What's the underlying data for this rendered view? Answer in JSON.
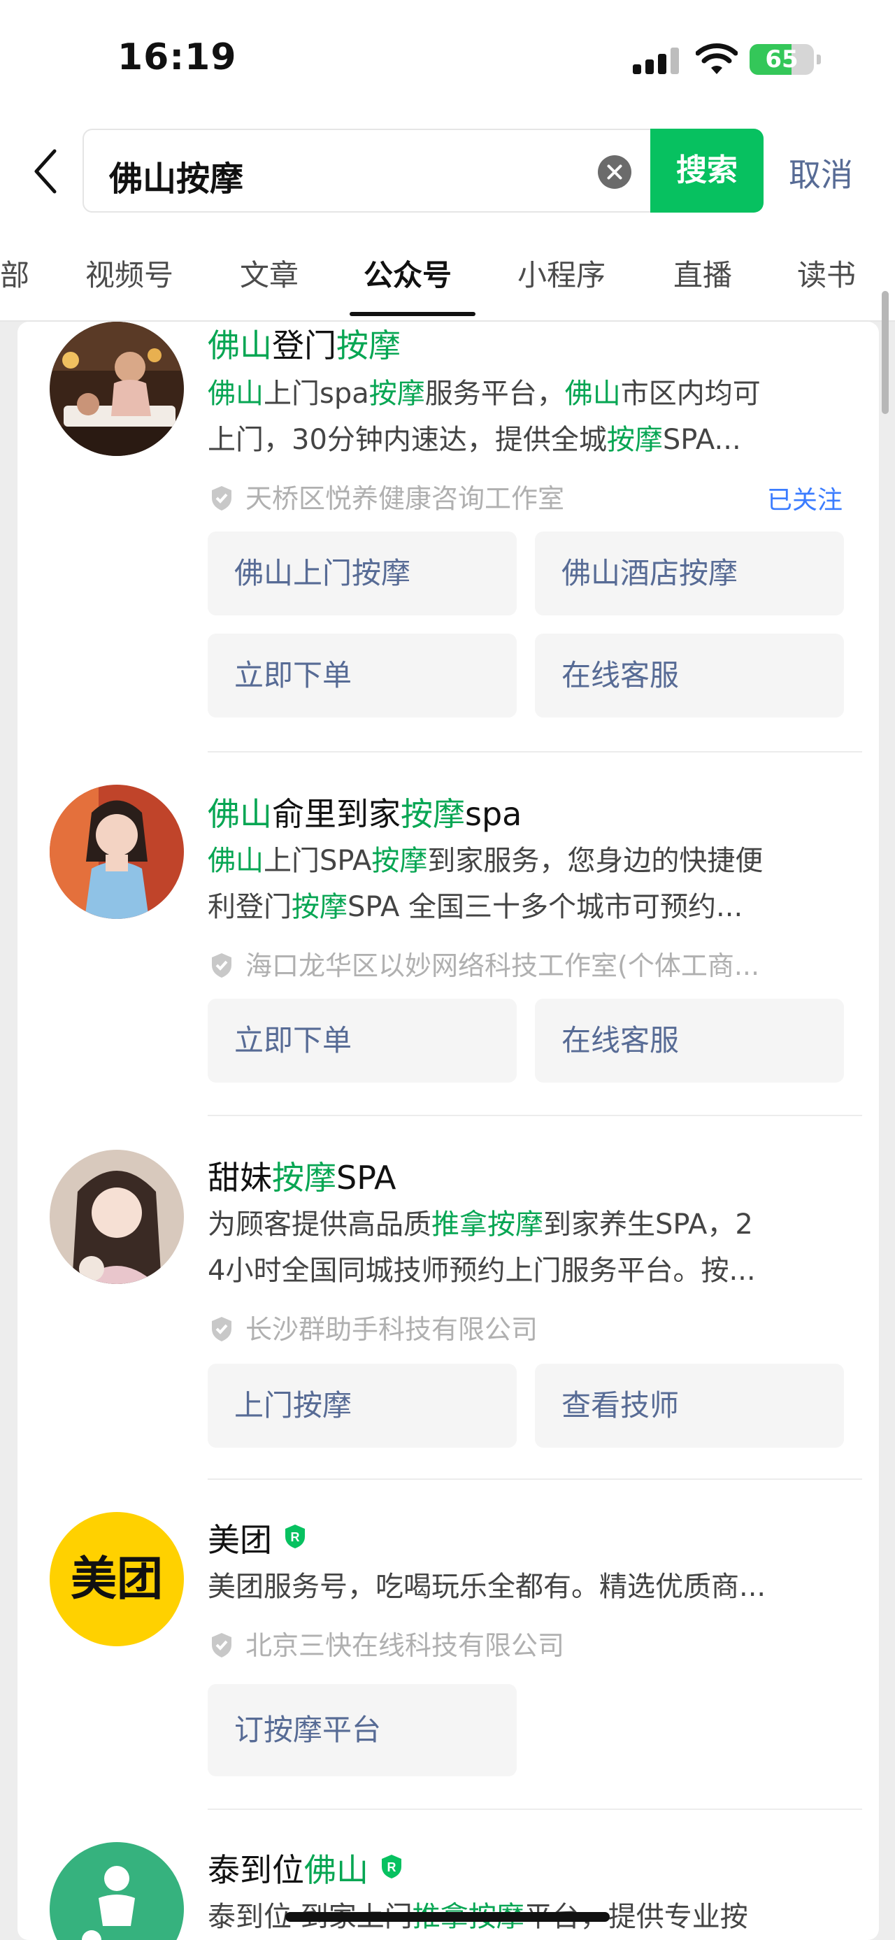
{
  "status_bar": {
    "time": "16:19",
    "battery": "65",
    "battery_level": 0.65
  },
  "search": {
    "query": "佛山按摩",
    "search_button": "搜索",
    "cancel": "取消"
  },
  "tabs": [
    {
      "label": "部"
    },
    {
      "label": "视频号"
    },
    {
      "label": "文章"
    },
    {
      "label": "公众号"
    },
    {
      "label": "小程序"
    },
    {
      "label": "直播"
    },
    {
      "label": "读书"
    }
  ],
  "active_tab": 3,
  "colors": {
    "accent_green": "#07c160",
    "highlight_green": "#07a653",
    "link_blue": "#576b95",
    "follow_blue": "#3b7cff"
  },
  "results": [
    {
      "title": [
        {
          "t": "佛山",
          "h": true
        },
        {
          "t": "登门",
          "h": false
        },
        {
          "t": "按摩",
          "h": true
        }
      ],
      "desc1": [
        {
          "t": "佛山",
          "h": true
        },
        {
          "t": "上门spa",
          "h": false
        },
        {
          "t": "按摩",
          "h": true
        },
        {
          "t": "服务平台，",
          "h": false
        },
        {
          "t": "佛山",
          "h": true
        },
        {
          "t": "市区内均可",
          "h": false
        }
      ],
      "desc2": [
        {
          "t": "上门，30分钟内速达，提供全城",
          "h": false
        },
        {
          "t": "按摩",
          "h": true
        },
        {
          "t": "SPA...",
          "h": false
        }
      ],
      "verified": "天桥区悦养健康咨询工作室",
      "follow": "已关注",
      "buttons": [
        "佛山上门按摩",
        "佛山酒店按摩",
        "立即下单",
        "在线客服"
      ]
    },
    {
      "title": [
        {
          "t": "佛山",
          "h": true
        },
        {
          "t": "俞里到家",
          "h": false
        },
        {
          "t": "按摩",
          "h": true
        },
        {
          "t": "spa",
          "h": false
        }
      ],
      "desc1": [
        {
          "t": "佛山",
          "h": true
        },
        {
          "t": "上门SPA",
          "h": false
        },
        {
          "t": "按摩",
          "h": true
        },
        {
          "t": "到家服务，您身边的快捷便",
          "h": false
        }
      ],
      "desc2": [
        {
          "t": "利登门",
          "h": false
        },
        {
          "t": "按摩",
          "h": true
        },
        {
          "t": "SPA 全国三十多个城市可预约...",
          "h": false
        }
      ],
      "verified": "海口龙华区以妙网络科技工作室(个体工商...",
      "buttons": [
        "立即下单",
        "在线客服"
      ]
    },
    {
      "title": [
        {
          "t": "甜妹",
          "h": false
        },
        {
          "t": "按摩",
          "h": true
        },
        {
          "t": "SPA",
          "h": false
        }
      ],
      "desc1": [
        {
          "t": "为顾客提供高品质",
          "h": false
        },
        {
          "t": "推拿按摩",
          "h": true
        },
        {
          "t": "到家养生SPA，2",
          "h": false
        }
      ],
      "desc2": [
        {
          "t": "4小时全国同城技师预约上门服务平台。按...",
          "h": false
        }
      ],
      "verified": "长沙群助手科技有限公司",
      "buttons": [
        "上门按摩",
        "查看技师"
      ]
    },
    {
      "title": [
        {
          "t": "美团",
          "h": false
        }
      ],
      "avatar_text": "美团",
      "desc1": [
        {
          "t": "美团服务号，吃喝玩乐全都有。精选优质商...",
          "h": false
        }
      ],
      "verified": "北京三快在线科技有限公司",
      "buttons": [
        "订按摩平台"
      ]
    },
    {
      "title": [
        {
          "t": "泰到位",
          "h": false
        },
        {
          "t": "佛山",
          "h": true
        }
      ],
      "desc1": [
        {
          "t": "泰到位 到家上门",
          "h": false
        },
        {
          "t": "推拿按摩",
          "h": true
        },
        {
          "t": "平台，提供专业按",
          "h": false
        }
      ]
    }
  ]
}
